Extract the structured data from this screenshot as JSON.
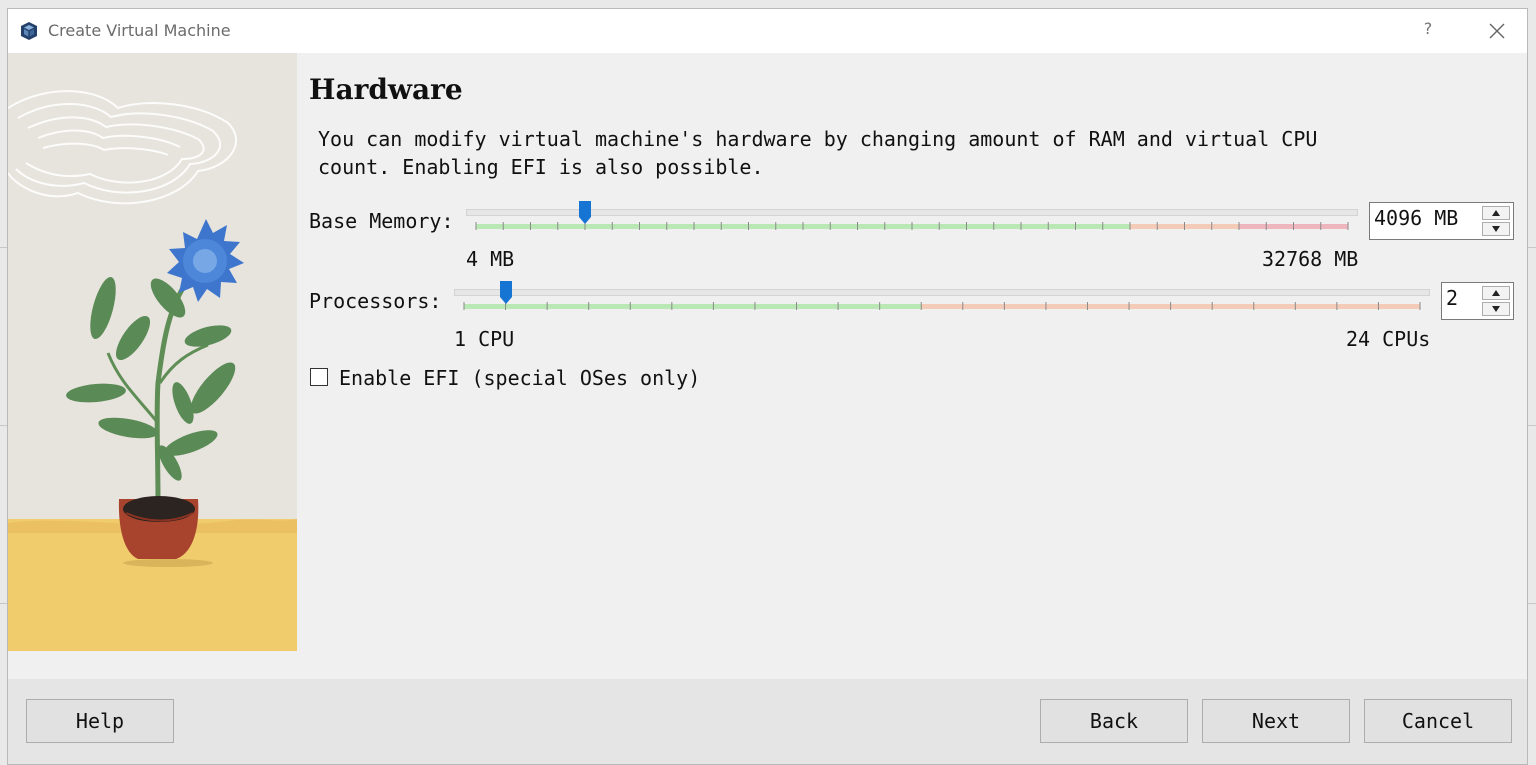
{
  "window": {
    "title": "Create Virtual Machine",
    "help_glyph": "?"
  },
  "page": {
    "heading": "Hardware",
    "description": "You can modify virtual machine's hardware by changing amount of RAM and virtual CPU count. Enabling EFI is also possible."
  },
  "memory": {
    "label": "Base Memory:",
    "value": "4096 MB",
    "min_label": "4 MB",
    "max_label": "32768 MB",
    "min": 4,
    "max": 32768,
    "current": 4096,
    "recommended_max": 24576,
    "warning_max": 28672
  },
  "processors": {
    "label": "Processors:",
    "value": "2",
    "min_label": "1 CPU",
    "max_label": "24 CPUs",
    "min": 1,
    "max": 24,
    "current": 2,
    "recommended_max": 12
  },
  "efi": {
    "label": "Enable EFI (special OSes only)",
    "checked": false
  },
  "buttons": {
    "help": "Help",
    "back": "Back",
    "next": "Next",
    "cancel": "Cancel"
  },
  "colors": {
    "scale_green": "#b9e8b4",
    "scale_orange": "#f4cbb7",
    "scale_red": "#eeb6bd",
    "handle_blue": "#1675d3",
    "illustration_sand": "#f1cc6c"
  },
  "icons": {
    "app": "virtualbox-cube-icon",
    "help": "question-mark-icon",
    "close": "close-icon",
    "spin_up": "triangle-up-icon",
    "spin_down": "triangle-down-icon"
  }
}
